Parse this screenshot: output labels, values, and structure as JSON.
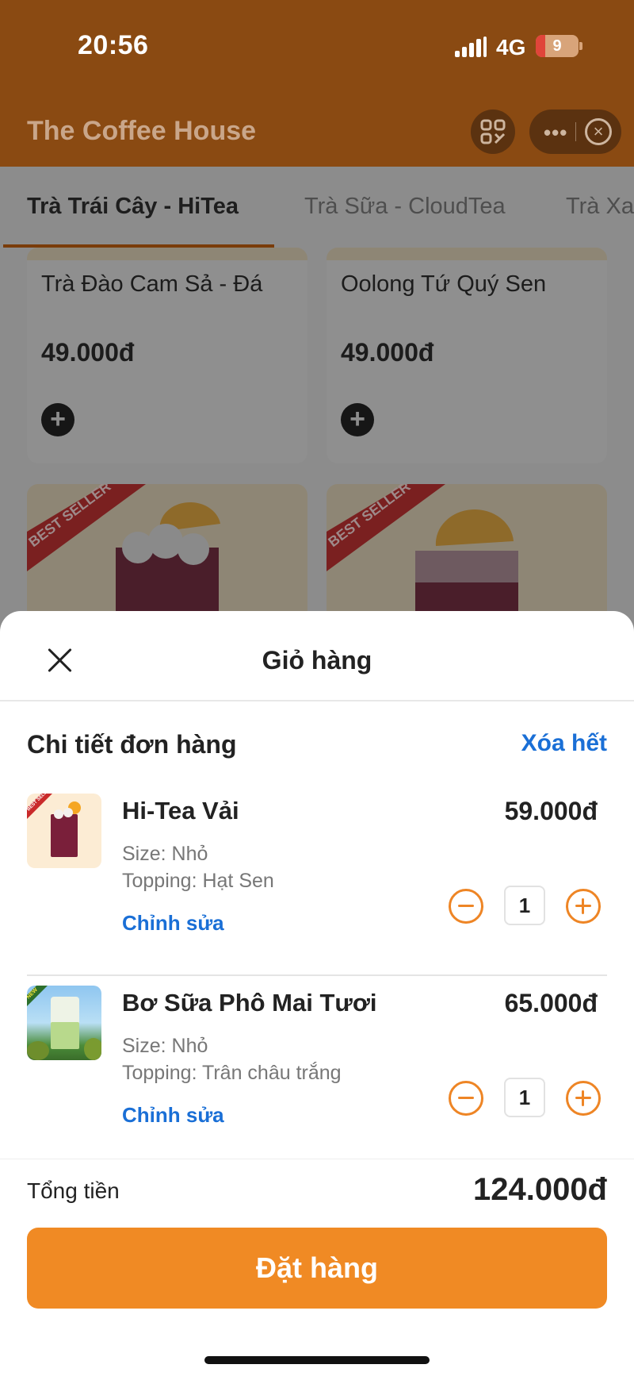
{
  "status": {
    "time": "20:56",
    "network": "4G",
    "battery": "9"
  },
  "header": {
    "title": "The Coffee House",
    "more_icon": "more-horizontal-icon",
    "close_icon": "close-circle-icon",
    "scan_icon": "qr-scan-icon"
  },
  "tabs": [
    {
      "label": "Trà Trái Cây - HiTea",
      "active": true
    },
    {
      "label": "Trà Sữa - CloudTea",
      "active": false
    },
    {
      "label": "Trà Xa",
      "active": false
    }
  ],
  "products": [
    {
      "name": "Trà Đào Cam Sả - Đá",
      "price": "49.000đ"
    },
    {
      "name": "Oolong Tứ Quý Sen",
      "price": "49.000đ"
    }
  ],
  "product_badges": [
    "BEST SELLER",
    "BEST SELLER"
  ],
  "cart": {
    "title": "Giỏ hàng",
    "section_title": "Chi tiết đơn hàng",
    "clear_all": "Xóa hết",
    "items": [
      {
        "name": "Hi-Tea Vải",
        "price": "59.000đ",
        "size": "Size: Nhỏ",
        "topping": "Topping: Hạt Sen",
        "edit": "Chỉnh sửa",
        "quantity": "1",
        "thumb_badge": "BEST SELLER"
      },
      {
        "name": "Bơ Sữa Phô Mai Tươi",
        "price": "65.000đ",
        "size": "Size: Nhỏ",
        "topping": "Topping: Trân châu trắng",
        "edit": "Chỉnh sửa",
        "quantity": "1",
        "thumb_badge": "NEW"
      }
    ],
    "total_label": "Tổng tiền",
    "total_value": "124.000đ",
    "order_button": "Đặt hàng"
  },
  "colors": {
    "brand_brown": "#8a4a12",
    "accent_orange": "#f08a24",
    "link_blue": "#1a6fd6"
  }
}
